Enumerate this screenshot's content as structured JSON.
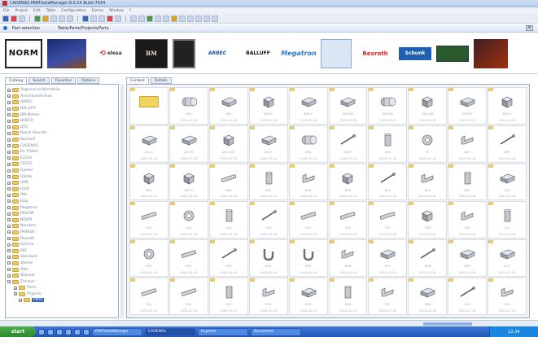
{
  "window": {
    "title": "CADENAS PARTdataManager 8.0.24 Build 7434"
  },
  "menu": [
    "File",
    "Project",
    "Edit",
    "Table",
    "Configuration",
    "Extras",
    "Window",
    "?"
  ],
  "panel": {
    "title": "Part selection",
    "path": "Table/Parts/Projects/Parts"
  },
  "logos": [
    {
      "name": "norm",
      "text": "NORM"
    },
    {
      "name": "elesa",
      "text": "elesa"
    },
    {
      "name": "bm",
      "text": "BM"
    },
    {
      "name": "arbec",
      "text": "ARBEC"
    },
    {
      "name": "balluff",
      "text": "BALLUFF"
    },
    {
      "name": "megatron",
      "text": "Megatron"
    },
    {
      "name": "rexroth",
      "text": "Rexroth"
    },
    {
      "name": "schunk",
      "text": "Schunk"
    }
  ],
  "left_tabs": [
    "Catalog",
    "Search",
    "Favorites",
    "Options"
  ],
  "right_tabs": [
    "Content",
    "Details"
  ],
  "tree": [
    "Allgemeine Normteile",
    "Anschlusstechnik",
    "ARBEC",
    "BALLUFF",
    "BM Motion",
    "BOSCH",
    "BTO",
    "Bosch Rexroth",
    "Bossard",
    "CADENAS",
    "Dr. Tretter",
    "ELESA",
    "FESTO",
    "Ganter",
    "Halder",
    "HEB",
    "IGUS",
    "INA",
    "Kipp",
    "Megatron",
    "MISUMI",
    "NORM",
    "Norelem",
    "PARKER",
    "Rexroth",
    "Schunk",
    "SKF",
    "Standard",
    "Steinel",
    "Otto",
    "Wiesner",
    "Zimmer",
    "Parts",
    "Projects",
    "Parts"
  ],
  "tree_selected": "Parts",
  "parts": [
    {
      "cap": "",
      "date": "",
      "shape": "folder"
    },
    {
      "cap": "A01",
      "date": "2004-02-16",
      "shape": "cyl"
    },
    {
      "cap": "A02",
      "date": "2004-02-16",
      "shape": "block"
    },
    {
      "cap": "A03-C",
      "date": "2004-02-16",
      "shape": "cube"
    },
    {
      "cap": "A04-2",
      "date": "2004-02-16",
      "shape": "block"
    },
    {
      "cap": "A05-3A",
      "date": "2004-02-16",
      "shape": "block"
    },
    {
      "cap": "A05-4A",
      "date": "2004-02-16",
      "shape": "cyl"
    },
    {
      "cap": "A05-4-B",
      "date": "2004-02-16",
      "shape": "cube"
    },
    {
      "cap": "A05-B7",
      "date": "2004-02-16",
      "shape": "block"
    },
    {
      "cap": "A05-C",
      "date": "2004-02-16",
      "shape": "cube"
    },
    {
      "cap": "A07-C",
      "date": "2004-02-16",
      "shape": "block"
    },
    {
      "cap": "A07-D",
      "date": "2004-02-16",
      "shape": "block"
    },
    {
      "cap": "A07-E-B7",
      "date": "2004-02-16",
      "shape": "cube"
    },
    {
      "cap": "A07-F",
      "date": "2004-02-16",
      "shape": "block"
    },
    {
      "cap": "A08",
      "date": "2004-02-16",
      "shape": "cyl"
    },
    {
      "cap": "A09-P",
      "date": "2004-02-16",
      "shape": "pin"
    },
    {
      "cap": "A10",
      "date": "2004-02-16",
      "shape": "tall"
    },
    {
      "cap": "B",
      "date": "2004-02-16",
      "shape": "ring"
    },
    {
      "cap": "B02",
      "date": "2004-02-16",
      "shape": "bracket"
    },
    {
      "cap": "B03",
      "date": "2004-02-16",
      "shape": "pin"
    },
    {
      "cap": "B04",
      "date": "2004-02-16",
      "shape": "cube"
    },
    {
      "cap": "B05-1",
      "date": "2004-02-16",
      "shape": "cube"
    },
    {
      "cap": "B06",
      "date": "2004-02-16",
      "shape": "rod"
    },
    {
      "cap": "B07",
      "date": "2004-02-16",
      "shape": "tall"
    },
    {
      "cap": "B08",
      "date": "2004-02-16",
      "shape": "bracket"
    },
    {
      "cap": "B09",
      "date": "2004-02-16",
      "shape": "cube"
    },
    {
      "cap": "B10",
      "date": "2004-02-16",
      "shape": "pin"
    },
    {
      "cap": "B11",
      "date": "2004-02-16",
      "shape": "bracket"
    },
    {
      "cap": "B12",
      "date": "2004-02-16",
      "shape": "tall"
    },
    {
      "cap": "B13",
      "date": "2004-02-16",
      "shape": "block"
    },
    {
      "cap": "C01",
      "date": "2004-02-16",
      "shape": "rod"
    },
    {
      "cap": "C02",
      "date": "2004-02-16",
      "shape": "ring"
    },
    {
      "cap": "C03",
      "date": "2004-02-16",
      "shape": "tall"
    },
    {
      "cap": "C04",
      "date": "2004-02-16",
      "shape": "pin"
    },
    {
      "cap": "C05",
      "date": "2004-02-16",
      "shape": "rod"
    },
    {
      "cap": "C06",
      "date": "2004-02-16",
      "shape": "rod"
    },
    {
      "cap": "C07",
      "date": "2004-02-16",
      "shape": "rod"
    },
    {
      "cap": "C08",
      "date": "2004-02-16",
      "shape": "cube"
    },
    {
      "cap": "C09",
      "date": "2004-02-16",
      "shape": "bracket"
    },
    {
      "cap": "C10",
      "date": "2004-02-16",
      "shape": "tall"
    },
    {
      "cap": "D01",
      "date": "2004-02-16",
      "shape": "ring"
    },
    {
      "cap": "D02",
      "date": "2004-02-16",
      "shape": "rod"
    },
    {
      "cap": "D03",
      "date": "2004-02-16",
      "shape": "pin"
    },
    {
      "cap": "D04",
      "date": "2004-02-16",
      "shape": "hook"
    },
    {
      "cap": "D05",
      "date": "2004-02-16",
      "shape": "hook"
    },
    {
      "cap": "D06",
      "date": "2004-02-16",
      "shape": "bracket"
    },
    {
      "cap": "D07",
      "date": "2004-02-16",
      "shape": "block"
    },
    {
      "cap": "D08",
      "date": "2004-02-16",
      "shape": "pin"
    },
    {
      "cap": "D09",
      "date": "2004-02-16",
      "shape": "block"
    },
    {
      "cap": "D10",
      "date": "2004-02-16",
      "shape": "block"
    },
    {
      "cap": "E01",
      "date": "2004-02-16",
      "shape": "rod"
    },
    {
      "cap": "E02",
      "date": "2004-02-16",
      "shape": "rod"
    },
    {
      "cap": "E03",
      "date": "2004-02-16",
      "shape": "tall"
    },
    {
      "cap": "E04",
      "date": "2004-02-16",
      "shape": "bracket"
    },
    {
      "cap": "E05",
      "date": "2004-02-16",
      "shape": "block"
    },
    {
      "cap": "E06",
      "date": "2004-02-16",
      "shape": "tall"
    },
    {
      "cap": "E07",
      "date": "2004-02-16",
      "shape": "bracket"
    },
    {
      "cap": "E08",
      "date": "2004-02-16",
      "shape": "block"
    },
    {
      "cap": "E09",
      "date": "2004-02-16",
      "shape": "pin"
    },
    {
      "cap": "E10",
      "date": "2004-02-16",
      "shape": "bracket"
    }
  ],
  "taskbar": {
    "start_label": "start",
    "tasks": [
      "PARTdataManager",
      "CADENAS",
      "Explorer",
      "Document"
    ],
    "clock": "12:34"
  }
}
